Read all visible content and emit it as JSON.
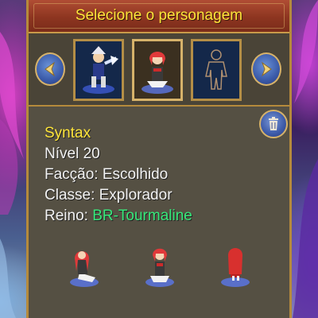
{
  "dialog": {
    "title": "Selecione o personagem"
  },
  "characters": [
    {
      "slot": "occupied-warrior-white",
      "selected": false
    },
    {
      "slot": "occupied-redhair-mage",
      "selected": true
    },
    {
      "slot": "empty",
      "selected": false
    }
  ],
  "selected_character": {
    "name": "Syntax",
    "level": "Nível 20",
    "faction_label": "Facção: Escolhido",
    "class_label": "Classe: Explorador",
    "realm_prefix": "Reino: ",
    "realm_value": "BR-Tourmaline"
  },
  "icons": {
    "prev": "chevron-left-icon",
    "next": "chevron-right-icon",
    "delete": "trash-icon"
  },
  "colors": {
    "title_text": "#ffe53a",
    "title_bar": "#8d3520",
    "name": "#ffe53a",
    "realm": "#36e87a",
    "frame_gold": "#b58a3c"
  }
}
